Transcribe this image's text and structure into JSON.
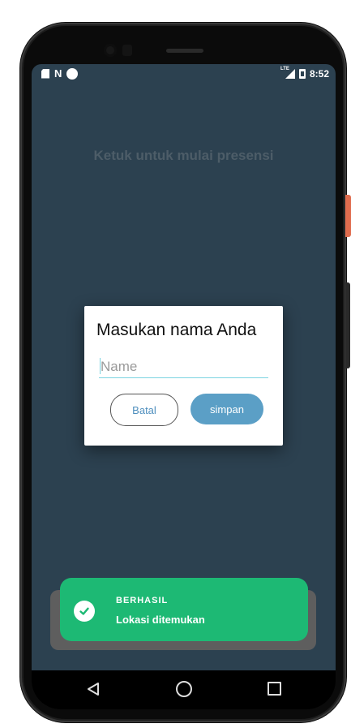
{
  "status_bar": {
    "time": "8:52",
    "left_icons": [
      "sd-card-icon",
      "n-icon",
      "dot-icon"
    ],
    "right_icons": [
      "lte-signal-icon",
      "battery-icon"
    ],
    "n_glyph": "N",
    "lte_label": "LTE"
  },
  "main": {
    "headline": "Ketuk untuk mulai presensi",
    "background_color": "#2c4150"
  },
  "dialog": {
    "title": "Masukan nama Anda",
    "input_placeholder": "Name",
    "input_value": "",
    "cancel_label": "Batal",
    "save_label": "simpan",
    "accent_color": "#5b9fc6"
  },
  "toast": {
    "title": "BERHASIL",
    "message": "Lokasi ditemukan",
    "icon": "check-circle-icon",
    "color": "#1db974"
  },
  "navbar": {
    "icons": [
      "back-icon",
      "home-icon",
      "recents-icon"
    ]
  }
}
